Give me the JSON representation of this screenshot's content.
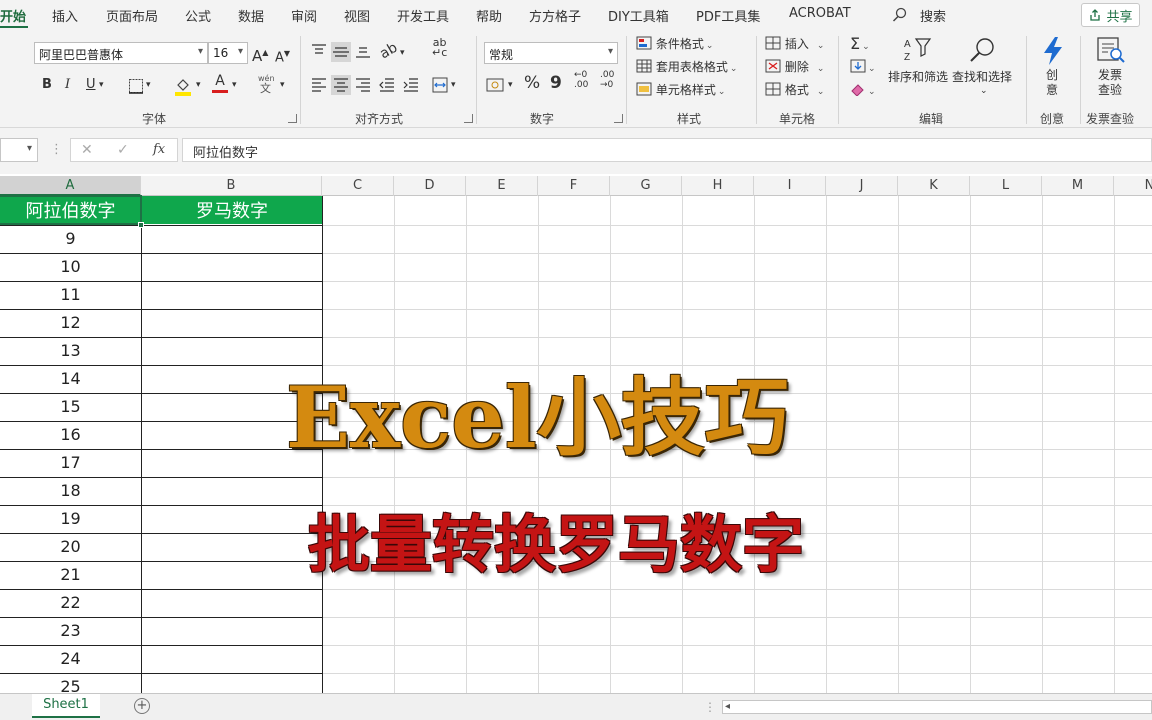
{
  "tabs": [
    "开始",
    "插入",
    "页面布局",
    "公式",
    "数据",
    "审阅",
    "视图",
    "开发工具",
    "帮助",
    "方方格子",
    "DIY工具箱",
    "PDF工具集",
    "ACROBAT",
    "搜索"
  ],
  "share_label": "共享",
  "ribbon": {
    "font_name": "阿里巴巴普惠体",
    "font_size": "16",
    "grow_font": "A",
    "shrink_font": "A",
    "bold": "B",
    "italic": "I",
    "underline": "U",
    "phonetic": "wén",
    "font_color_glyph": "A",
    "number_format": "常规",
    "percent": "%",
    "comma": "9",
    "increase_decimal": "←0\n.00",
    "decrease_decimal": ".00\n→0",
    "conditional_format": "条件格式",
    "table_format": "套用表格格式",
    "cell_style": "单元格样式",
    "insert": "插入",
    "delete": "删除",
    "format": "格式",
    "sort_filter": "排序和筛选",
    "find_select": "查找和选择",
    "creative": "创\n意",
    "invoice_check": "发票\n查验",
    "group_labels": {
      "font": "字体",
      "alignment": "对齐方式",
      "number": "数字",
      "styles": "样式",
      "cells": "单元格",
      "editing": "编辑",
      "creative": "创意",
      "invoice": "发票查验"
    }
  },
  "formula_bar": {
    "cancel": "✕",
    "confirm": "✓",
    "fx": "fx",
    "value": "阿拉伯数字"
  },
  "columns": [
    "A",
    "B",
    "C",
    "D",
    "E",
    "F",
    "G",
    "H",
    "I",
    "J",
    "K",
    "L",
    "M",
    "N"
  ],
  "sheet": {
    "header_a": "阿拉伯数字",
    "header_b": "罗马数字",
    "values": [
      "9",
      "10",
      "11",
      "12",
      "13",
      "14",
      "15",
      "16",
      "17",
      "18",
      "19",
      "20",
      "21",
      "22",
      "23",
      "24",
      "25"
    ]
  },
  "overlay": {
    "title": "Excel小技巧",
    "subtitle": "批量转换罗马数字"
  },
  "sheet_tabs": [
    "Sheet1"
  ],
  "add_sheet": "+",
  "colors": {
    "accent": "#1e7145",
    "header_fill": "#0fa74c",
    "title": "#d48a10",
    "subtitle": "#c41414"
  }
}
